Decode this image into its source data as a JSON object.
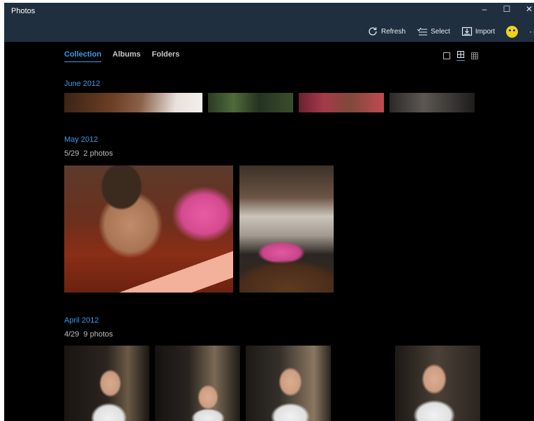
{
  "app": {
    "title": "Photos"
  },
  "window_controls": {
    "minimize": "–",
    "maximize": "☐",
    "close": "✕"
  },
  "toolbar": {
    "refresh": "Refresh",
    "select": "Select",
    "import": "Import",
    "more": "···"
  },
  "nav": {
    "tabs": [
      {
        "label": "Collection",
        "active": true
      },
      {
        "label": "Albums"
      },
      {
        "label": "Folders"
      }
    ]
  },
  "groups": [
    {
      "title": "June 2012"
    },
    {
      "title": "May 2012",
      "date": "5/29",
      "count": "2 photos"
    },
    {
      "title": "April 2012",
      "date": "4/29",
      "count": "9 photos"
    }
  ],
  "colors": {
    "accent": "#3a9bea",
    "titlebar": "#1f2f3f",
    "background": "#000000"
  },
  "icons": [
    "refresh-icon",
    "select-icon",
    "import-icon",
    "avatar",
    "single-view-icon",
    "medium-grid-icon",
    "small-grid-icon"
  ]
}
